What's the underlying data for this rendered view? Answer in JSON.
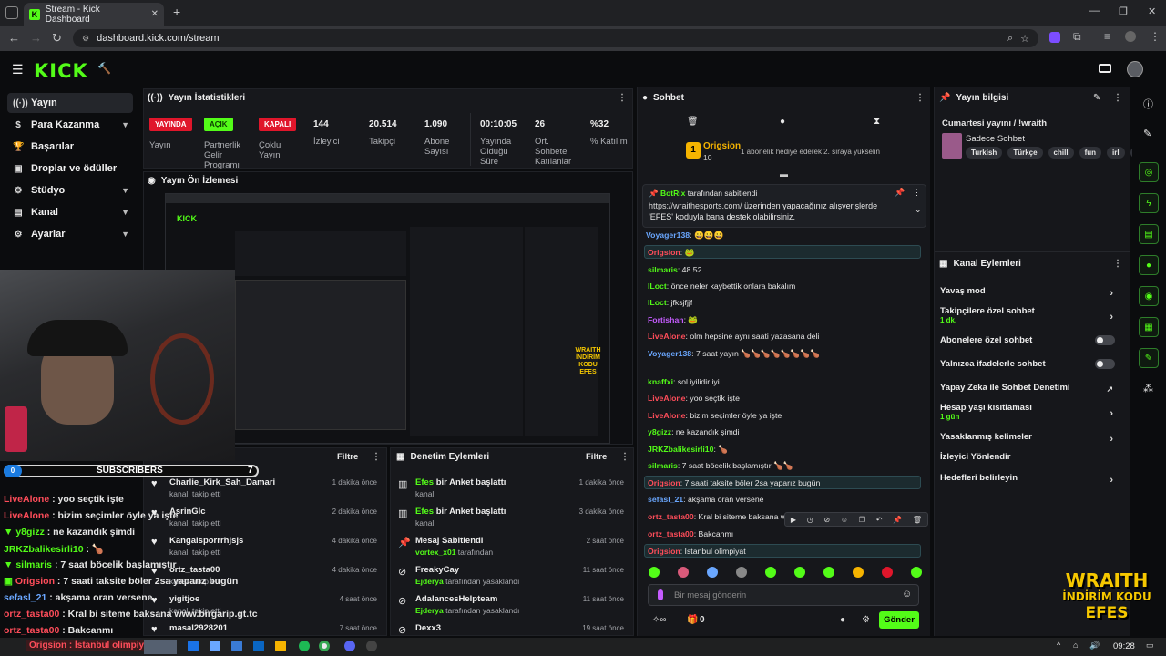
{
  "browser": {
    "tab_title": "Stream - Kick Dashboard",
    "url": "dashboard.kick.com/stream"
  },
  "kick": {
    "logo": "KICK"
  },
  "sidebar": {
    "items": [
      {
        "label": "Yayın",
        "icon": "broadcast-icon"
      },
      {
        "label": "Para Kazanma",
        "icon": "dollar-icon"
      },
      {
        "label": "Başarılar",
        "icon": "trophy-icon"
      },
      {
        "label": "Droplar ve ödüller",
        "icon": "gift-icon"
      },
      {
        "label": "Stüdyo",
        "icon": "gear-icon"
      },
      {
        "label": "Kanal",
        "icon": "layout-icon"
      },
      {
        "label": "Ayarlar",
        "icon": "settings-icon"
      }
    ]
  },
  "stats": {
    "title": "Yayın İstatistikleri",
    "badges": [
      {
        "text": "YAYINDA",
        "label1": "Yayın",
        "label2": "",
        "label3": "",
        "color": "#e0162b"
      },
      {
        "text": "AÇIK",
        "label1": "Partnerlik",
        "label2": "Gelir",
        "label3": "Programı",
        "color": "#53fc18"
      },
      {
        "text": "KAPALI",
        "label1": "Çoklu",
        "label2": "Yayın",
        "label3": "",
        "color": "#e0162b"
      }
    ],
    "numbers": [
      {
        "value": "144",
        "label1": "İzleyici",
        "label2": "",
        "label3": ""
      },
      {
        "value": "20.514",
        "label1": "Takipçi",
        "label2": "",
        "label3": ""
      },
      {
        "value": "1.090",
        "label1": "Abone",
        "label2": "Sayısı",
        "label3": ""
      },
      {
        "value": "00:10:05",
        "label1": "Yayında",
        "label2": "Olduğu",
        "label3": "Süre"
      },
      {
        "value": "26",
        "label1": "Ort.",
        "label2": "Sohbete",
        "label3": "Katılanlar"
      },
      {
        "value": "%32",
        "label1": "% Katılım",
        "label2": "",
        "label3": ""
      }
    ]
  },
  "preview": {
    "title": "Yayın Ön İzlemesi",
    "wraith1": "WRAITH",
    "wraith2": "İNDİRİM KODU",
    "wraith3": "EFES"
  },
  "activity": {
    "filter": "Filtre",
    "rows": [
      {
        "name": "Charlie_Kirk_Sah_Damari",
        "sub": "kanalı takip etti",
        "time": "1 dakika önce"
      },
      {
        "name": "AsrinGlc",
        "sub": "kanalı takip etti",
        "time": "2 dakika önce"
      },
      {
        "name": "Kangalsporrrhjsjs",
        "sub": "kanalı takip etti",
        "time": "4 dakika önce"
      },
      {
        "name": "ortz_tasta00",
        "sub": "kanalı takip etti",
        "time": "4 dakika önce"
      },
      {
        "name": "yigitjoe",
        "sub": "kanalı takip etti",
        "time": "4 saat önce"
      },
      {
        "name": "masal2928201",
        "sub": "",
        "time": "7 saat önce"
      }
    ]
  },
  "moderation": {
    "title": "Denetim Eylemleri",
    "filter": "Filtre",
    "rows": [
      {
        "name": "Efes",
        "name2": " bir Anket başlattı",
        "sub": "kanalı",
        "sub2": "",
        "time": "1 dakika önce"
      },
      {
        "name": "Efes",
        "name2": " bir Anket başlattı",
        "sub": "kanalı",
        "sub2": "",
        "time": "3 dakika önce"
      },
      {
        "name": "Mesaj Sabitlendi",
        "name2": "",
        "sub": "vortex_x01",
        "sub2": " tarafından",
        "time": "2 saat önce"
      },
      {
        "name": "FreakyCay",
        "name2": "",
        "sub": "Ejderya",
        "sub2": " tarafından yasaklandı",
        "time": "11 saat önce"
      },
      {
        "name": "AdalancesHelpteam",
        "name2": "",
        "sub": "Ejderya",
        "sub2": " tarafından yasaklandı",
        "time": "11 saat önce"
      },
      {
        "name": "Dexx3",
        "name2": "",
        "sub": "",
        "sub2": "",
        "time": "19 saat önce"
      }
    ]
  },
  "chat": {
    "title": "Sohbet",
    "top_user": "Origsion",
    "top_count": "10",
    "top_msg": "1 abonelik hediye ederek 2. sıraya yükselin",
    "pinned_by": "BotRix",
    "pinned_by_suffix": " tarafından sabitlendi",
    "pinned_link": "https://wraithesports.com/",
    "pinned_text1": " üzerinden yapacağınız alışverişlerde",
    "pinned_text2": "'EFES' koduyla bana destek olabilirsiniz.",
    "messages": [
      {
        "user": "Voyager138",
        "text": ": 😀😀😀",
        "color": "#6aa7ff",
        "hl": false
      },
      {
        "user": "Origsion",
        "text": ": 🐸",
        "color": "#ff4d5a",
        "hl": true
      },
      {
        "user": "silmaris",
        "text": ": 48 52",
        "color": "#53fc18",
        "hl": false
      },
      {
        "user": "ILoct",
        "text": ": önce neler kaybettik onlara bakalım",
        "color": "#53fc18",
        "hl": false
      },
      {
        "user": "ILoct",
        "text": ": jfksjfjjf",
        "color": "#53fc18",
        "hl": false
      },
      {
        "user": "Fortishan",
        "text": ": 🐸",
        "color": "#c55cff",
        "hl": false
      },
      {
        "user": "LiveAlone",
        "text": ": olm hepsine aynı saati yazasana deli",
        "color": "#ff4d5a",
        "hl": false
      },
      {
        "user": "Voyager138",
        "text": ": 7 saat yayın 🍗🍗🍗🍗🍗🍗🍗🍗",
        "color": "#6aa7ff",
        "hl": false
      },
      {
        "user": "knaffxi",
        "text": ": sol iyilidir iyi",
        "color": "#53fc18",
        "hl": false
      },
      {
        "user": "LiveAlone",
        "text": ": yoo seçtik işte",
        "color": "#ff4d5a",
        "hl": false
      },
      {
        "user": "LiveAlone",
        "text": ": bizim seçimler öyle ya işte",
        "color": "#ff4d5a",
        "hl": false
      },
      {
        "user": "y8gizz",
        "text": ": ne kazandık şimdi",
        "color": "#53fc18",
        "hl": false
      },
      {
        "user": "JRKZbalikesirli10",
        "text": ": 🍗",
        "color": "#53fc18",
        "hl": false
      },
      {
        "user": "silmaris",
        "text": ": 7 saat böcelik başlamıştır 🍗🍗",
        "color": "#53fc18",
        "hl": false
      },
      {
        "user": "Origsion",
        "text": ": 7 saati taksite böler 2sa yaparız bugün",
        "color": "#ff4d5a",
        "hl": true
      },
      {
        "user": "sefasl_21",
        "text": ": akşama oran versene",
        "color": "#6aa7ff",
        "hl": false
      },
      {
        "user": "ortz_tasta00",
        "text": ": Kral bi siteme baksana ww",
        "color": "#ff4d5a",
        "hl": false
      },
      {
        "user": "ortz_tasta00",
        "text": ": Bakcanmı",
        "color": "#ff4d5a",
        "hl": false
      },
      {
        "user": "Origsion",
        "text": ": İstanbul olimpiyat",
        "color": "#ff4d5a",
        "hl": true
      }
    ],
    "input_placeholder": "Bir mesaj gönderin",
    "points": "0",
    "send": "Gönder"
  },
  "stream_info": {
    "title": "Yayın bilgisi",
    "stream_title": "Cumartesi yayını / !wraith",
    "category": "Sadece Sohbet",
    "tags": [
      "Turkish",
      "Türkçe",
      "chill",
      "fun",
      "irl",
      "izm"
    ]
  },
  "channel_actions": {
    "title": "Kanal Eylemleri",
    "rows": [
      {
        "label": "Yavaş mod",
        "sub": "",
        "control": "chevron"
      },
      {
        "label": "Takipçilere özel sohbet",
        "sub": "1 dk.",
        "control": "chevron"
      },
      {
        "label": "Abonelere özel sohbet",
        "sub": "",
        "control": "toggle"
      },
      {
        "label": "Yalnızca ifadelerle sohbet",
        "sub": "",
        "control": "toggle"
      },
      {
        "label": "Yapay Zeka ile Sohbet Denetimi",
        "sub": "",
        "control": "external"
      },
      {
        "label": "Hesap yaşı kısıtlaması",
        "sub": "1 gün",
        "control": "chevron"
      },
      {
        "label": "Yasaklanmış kelimeler",
        "sub": "",
        "control": "chevron"
      },
      {
        "label": "İzleyici Yönlendir",
        "sub": "",
        "control": "none"
      },
      {
        "label": "Hedefleri belirleyin",
        "sub": "",
        "control": "chevron"
      }
    ]
  },
  "overlay": {
    "subs_label": "SUBSCRIBERS",
    "subs_count": "7",
    "subs_progress": "0",
    "lines": [
      {
        "user": "LiveAlone",
        "text": " : yoo seçtik işte",
        "color": "#ff4d5a"
      },
      {
        "user": "LiveAlone",
        "text": " : bizim seçimler öyle ya işte",
        "color": "#ff4d5a"
      },
      {
        "user": "y8gizz",
        "text": " : ne kazandık şimdi",
        "color": "#53fc18"
      },
      {
        "user": "JRKZbalikesirli10",
        "text": " : 🍗",
        "color": "#53fc18"
      },
      {
        "user": "silmaris",
        "text": " : 7 saat böcelik başlamıştır",
        "color": "#53fc18"
      },
      {
        "user": "Origsion",
        "text": " : 7 saati taksite böler 2sa yaparız bugün",
        "color": "#ff4d5a"
      },
      {
        "user": "sefasl_21",
        "text": " : akşama oran versene",
        "color": "#6aa7ff"
      },
      {
        "user": "ortz_tasta00",
        "text": " : Kral bi siteme baksana www.birgarip.gt.tc",
        "color": "#ff4d5a"
      },
      {
        "user": "ortz_tasta00",
        "text": " : Bakcanmı",
        "color": "#ff4d5a"
      }
    ],
    "bottom": "Origsion : İstanbul olimpiyat",
    "wraith1": "WRAITH",
    "wraith2": "İNDİRİM KODU",
    "wraith3": "EFES"
  },
  "taskbar": {
    "time": "09:28"
  }
}
